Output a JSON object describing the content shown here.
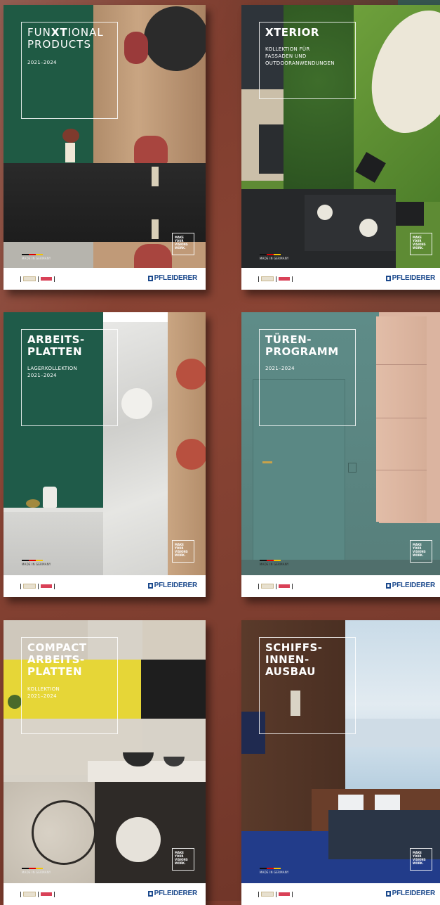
{
  "brochures": [
    {
      "title_pre": "FUN",
      "title_bold": "XT",
      "title_post": "IONAL\nPRODUCTS",
      "subtitle": "2021–2024",
      "tagline": "MAKE\nYOUR\nVISIONS\nWORK.",
      "made_in": "MADE IN GERMANY",
      "logo": "PFLEIDERER"
    },
    {
      "title": "XTERIOR",
      "subtitle": "KOLLEKTION FÜR\nFASSADEN UND\nOUTDOORANWENDUNGEN",
      "tagline": "MAKE\nYOUR\nVISIONS\nWORK.",
      "made_in": "MADE IN GERMANY",
      "logo": "PFLEIDERER"
    },
    {
      "title": "ARBEITS-\nPLATTEN",
      "subtitle": "LAGERKOLLEKTION\n2021–2024",
      "tagline": "MAKE\nYOUR\nVISIONS\nWORK.",
      "made_in": "MADE IN GERMANY",
      "logo": "PFLEIDERER"
    },
    {
      "title": "TÜREN-\nPROGRAMM",
      "subtitle": "2021–2024",
      "tagline": "MAKE\nYOUR\nVISIONS\nWORK.",
      "made_in": "MADE IN GERMANY",
      "logo": "PFLEIDERER"
    },
    {
      "title": "COMPACT\nARBEITS-\nPLATTEN",
      "subtitle": "KOLLEKTION\n2021–2024",
      "tagline": "MAKE\nYOUR\nVISIONS\nWORK.",
      "made_in": "MADE IN GERMANY",
      "logo": "PFLEIDERER"
    },
    {
      "title": "SCHIFFS-\nINNEN-\nAUSBAU",
      "subtitle": "",
      "tagline": "MAKE\nYOUR\nVISIONS\nWORK.",
      "made_in": "MADE IN GERMANY",
      "logo": "PFLEIDERER"
    }
  ],
  "colors": {
    "background": "#7e3f30",
    "brand_blue": "#1c4a8d",
    "frame": "#ffffff"
  }
}
